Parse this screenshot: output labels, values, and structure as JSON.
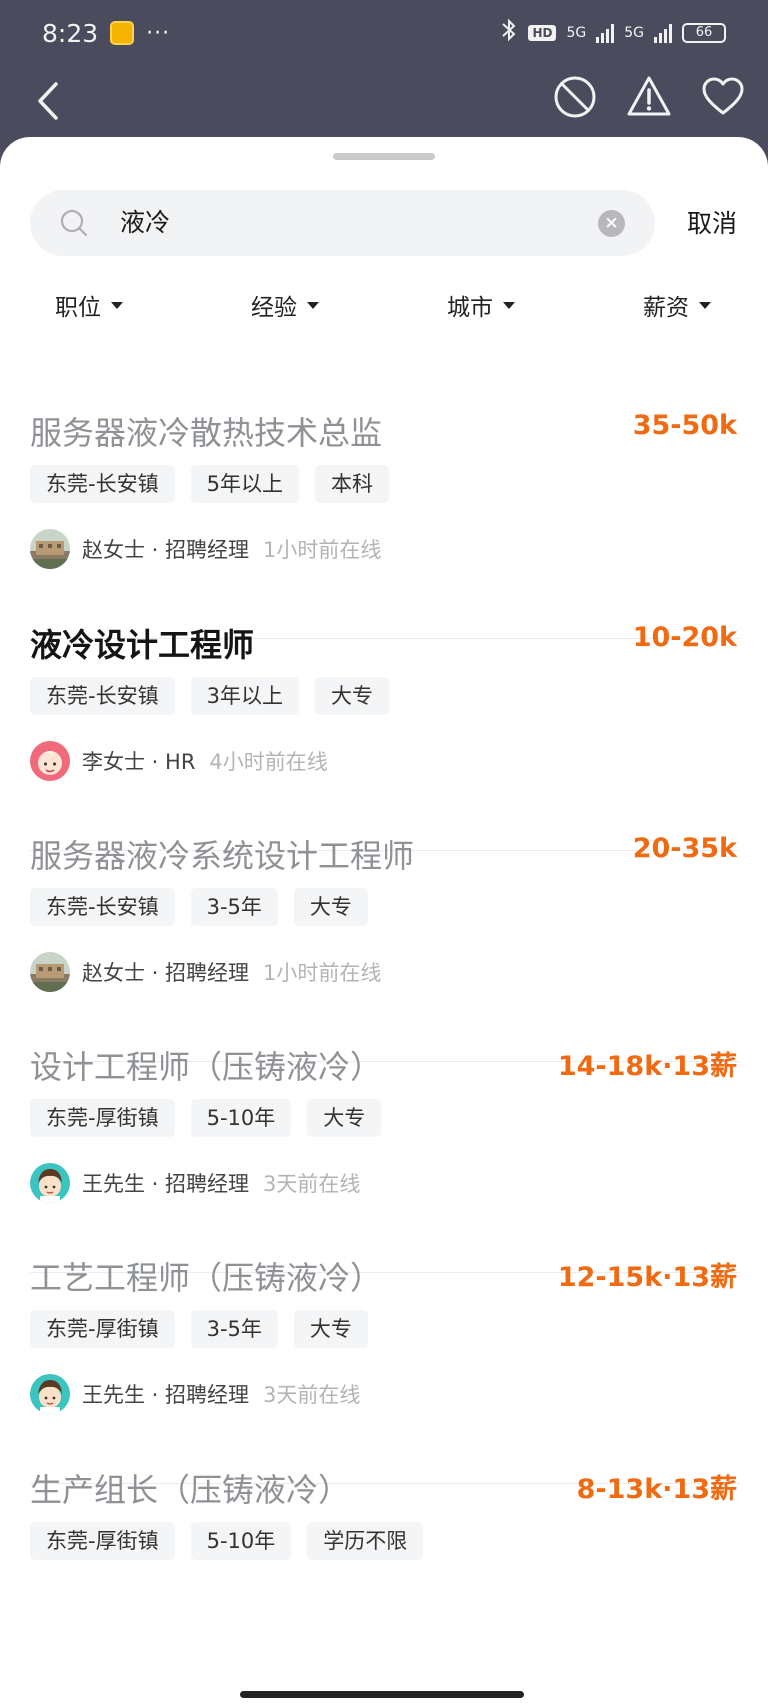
{
  "status_bar": {
    "time": "8:23",
    "dots": "···",
    "hd_label": "HD",
    "signal_label_1": "5G",
    "signal_label_2": "5G",
    "battery": "66"
  },
  "nav": {
    "back_icon": "chevron-left-icon",
    "actions": [
      "block-icon",
      "warning-icon",
      "heart-icon"
    ]
  },
  "search": {
    "query": "液冷",
    "cancel_label": "取消"
  },
  "filters": [
    "职位",
    "经验",
    "城市",
    "薪资"
  ],
  "jobs": [
    {
      "title": "服务器液冷散热技术总监",
      "salary": "35-50k",
      "tags": [
        "东莞-长安镇",
        "5年以上",
        "本科"
      ],
      "recruiter": "赵女士 · 招聘经理",
      "online": "1小时前在线",
      "avatar": "building-avatar"
    },
    {
      "title": "液冷设计工程师",
      "salary": "10-20k",
      "tags": [
        "东莞-长安镇",
        "3年以上",
        "大专"
      ],
      "recruiter": "李女士 · HR",
      "online": "4小时前在线",
      "avatar": "girl-avatar"
    },
    {
      "title": "服务器液冷系统设计工程师",
      "salary": "20-35k",
      "tags": [
        "东莞-长安镇",
        "3-5年",
        "大专"
      ],
      "recruiter": "赵女士 · 招聘经理",
      "online": "1小时前在线",
      "avatar": "building-avatar"
    },
    {
      "title": "设计工程师（压铸液冷）",
      "salary": "14-18k·13薪",
      "tags": [
        "东莞-厚街镇",
        "5-10年",
        "大专"
      ],
      "recruiter": "王先生 · 招聘经理",
      "online": "3天前在线",
      "avatar": "boy-avatar"
    },
    {
      "title": "工艺工程师（压铸液冷）",
      "salary": "12-15k·13薪",
      "tags": [
        "东莞-厚街镇",
        "3-5年",
        "大专"
      ],
      "recruiter": "王先生 · 招聘经理",
      "online": "3天前在线",
      "avatar": "boy-avatar"
    },
    {
      "title": "生产组长（压铸液冷）",
      "salary": "8-13k·13薪",
      "tags": [
        "东莞-厚街镇",
        "5-10年",
        "学历不限"
      ]
    }
  ]
}
